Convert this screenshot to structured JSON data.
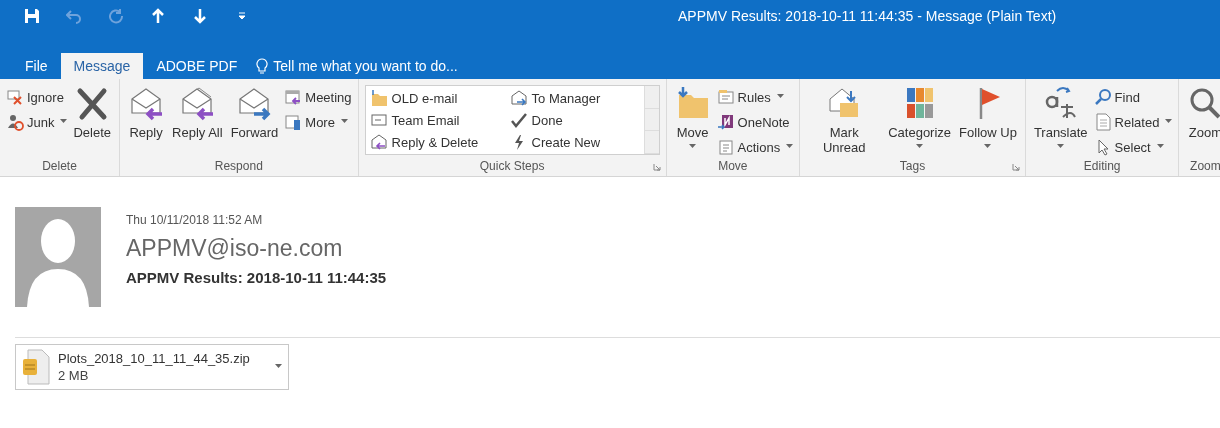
{
  "window": {
    "title": "APPMV Results: 2018-10-11 11:44:35 - Message (Plain Text)"
  },
  "tabs": [
    {
      "label": "File",
      "selected": false
    },
    {
      "label": "Message",
      "selected": true
    },
    {
      "label": "ADOBE PDF",
      "selected": false
    }
  ],
  "tell_me": {
    "placeholder": "Tell me what you want to do..."
  },
  "ribbon_groups": [
    {
      "label": "Delete",
      "launcher": false,
      "items": [
        {
          "kind": "stack",
          "buttons": [
            {
              "label": "Ignore",
              "dropdown": false
            },
            {
              "label": "Junk",
              "dropdown": true
            }
          ]
        },
        {
          "kind": "large",
          "label": "Delete",
          "dropdown": false
        }
      ]
    },
    {
      "label": "Respond",
      "launcher": false,
      "items": [
        {
          "kind": "large",
          "label": "Reply",
          "dropdown": false
        },
        {
          "kind": "large",
          "label": "Reply All",
          "dropdown": false
        },
        {
          "kind": "large",
          "label": "Forward",
          "dropdown": false
        },
        {
          "kind": "stack",
          "buttons": [
            {
              "label": "Meeting",
              "dropdown": false
            },
            {
              "label": "More",
              "dropdown": true
            }
          ]
        }
      ]
    },
    {
      "label": "Quick Steps",
      "launcher": true,
      "items": [
        {
          "kind": "gallery",
          "steps": [
            "OLD e-mail",
            "To Manager",
            "Team Email",
            "Done",
            "Reply & Delete",
            "Create New"
          ]
        }
      ]
    },
    {
      "label": "Move",
      "launcher": false,
      "items": [
        {
          "kind": "large",
          "label": "Move",
          "dropdown": true
        },
        {
          "kind": "stack",
          "buttons": [
            {
              "label": "Rules",
              "dropdown": true
            },
            {
              "label": "OneNote",
              "dropdown": false
            },
            {
              "label": "Actions",
              "dropdown": true
            }
          ]
        }
      ]
    },
    {
      "label": "Tags",
      "launcher": true,
      "items": [
        {
          "kind": "large",
          "label": "Mark Unread",
          "dropdown": false
        },
        {
          "kind": "large",
          "label": "Categorize",
          "dropdown": true
        },
        {
          "kind": "large",
          "label": "Follow Up",
          "dropdown": true
        }
      ]
    },
    {
      "label": "Editing",
      "launcher": false,
      "items": [
        {
          "kind": "large",
          "label": "Translate",
          "dropdown": true
        },
        {
          "kind": "stack",
          "buttons": [
            {
              "label": "Find",
              "dropdown": false
            },
            {
              "label": "Related",
              "dropdown": true
            },
            {
              "label": "Select",
              "dropdown": true
            }
          ]
        }
      ]
    },
    {
      "label": "Zoom",
      "launcher": false,
      "items": [
        {
          "kind": "large",
          "label": "Zoom",
          "dropdown": false
        }
      ]
    }
  ],
  "message": {
    "date": "Thu 10/11/2018 11:52 AM",
    "sender": "APPMV@iso-ne.com",
    "subject": "APPMV Results: 2018-10-11 11:44:35"
  },
  "attachments": [
    {
      "name": "Plots_2018_10_11_11_44_35.zip",
      "size": "2 MB"
    }
  ]
}
